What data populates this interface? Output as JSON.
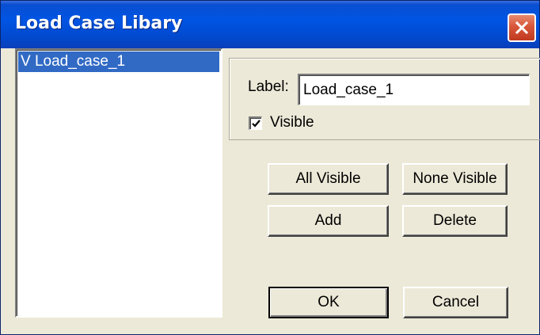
{
  "window": {
    "title": "Load Case Libary"
  },
  "titlebar": {
    "close_icon": "close-icon",
    "close_color": "#d8573a",
    "bar_color": "#0054e3"
  },
  "list": {
    "items": [
      {
        "label": "V Load_case_1",
        "selected": true
      }
    ],
    "selection_color": "#316ac5"
  },
  "properties": {
    "label_caption": "Label:",
    "label_value": "Load_case_1",
    "visible_caption": "Visible",
    "visible_checked": true
  },
  "buttons": {
    "all_visible": "All Visible",
    "none_visible": "None Visible",
    "add": "Add",
    "delete": "Delete",
    "ok": "OK",
    "cancel": "Cancel"
  }
}
